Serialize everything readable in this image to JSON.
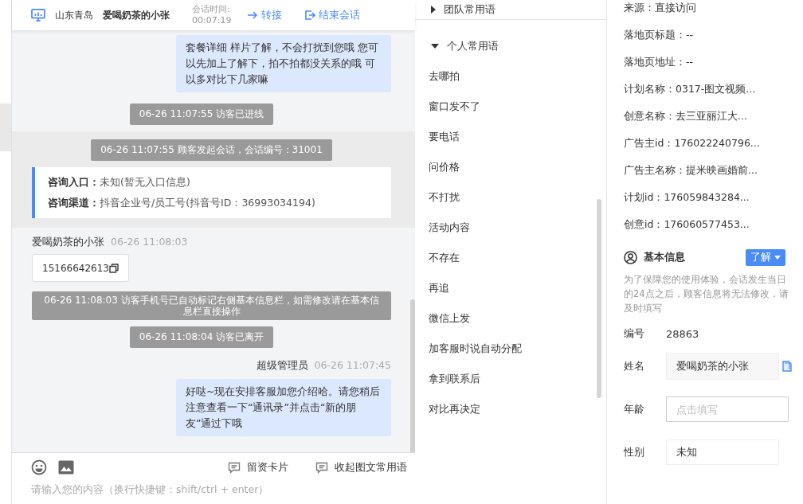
{
  "header": {
    "location": "山东青岛",
    "visitor": "爱喝奶茶的小张",
    "time_label": "会话时间:",
    "time": "00:07:19",
    "actions": [
      {
        "label": "转接",
        "kind": "transfer"
      },
      {
        "label": "结束会话",
        "kind": "end"
      }
    ]
  },
  "messages": [
    {
      "kind": "agent",
      "text": "套餐详细 样片了解，不会打扰到您哦 您可以先加上了解下，拍不拍都没关系的哦 可以多对比下几家嘛"
    },
    {
      "kind": "system",
      "text": "06-26 11:07:55 访客已进线"
    },
    {
      "kind": "session",
      "notice": "06-26 11:07:55 顾客发起会话，会话编号：31001",
      "entries": [
        {
          "label": "咨询入口：",
          "value": "未知(暂无入口信息)"
        },
        {
          "label": "咨询渠道：",
          "value": "抖音企业号/员工号(抖音号ID：36993034194)"
        }
      ]
    },
    {
      "kind": "visitor",
      "name": "爱喝奶茶的小张",
      "time": "06-26 11:08:03",
      "text": "15166642613"
    },
    {
      "kind": "notice",
      "text": "06-26 11:08:03 访客手机号已自动标记右侧基本信息栏，如需修改请在基本信息栏直接操作"
    },
    {
      "kind": "system",
      "text": "06-26 11:08:04 访客已离开"
    },
    {
      "kind": "agent",
      "name": "超级管理员",
      "time": "06-26 11:07:45",
      "text": "好哒~现在安排客服加您介绍哈。请您稍后注意查看一下“通讯录”并点击“新的朋友”通过下哦"
    }
  ],
  "input": {
    "placeholder": "请输入您的内容（换行快捷键：shift/ctrl + enter）"
  },
  "quick_replies": {
    "groups": [
      {
        "title": "团队常用语",
        "expanded": false
      },
      {
        "title": "个人常用语",
        "expanded": true,
        "items": [
          "去哪拍",
          "窗口发不了",
          "要电话",
          "问价格",
          "不打扰",
          "活动内容",
          "不存在",
          "再追",
          "微信上发",
          "加客服时说自动分配",
          "拿到联系后",
          "对比再决定"
        ]
      }
    ],
    "buttons": [
      {
        "label": "留资卡片"
      },
      {
        "label": "收起图文常用语"
      }
    ]
  },
  "source_info": [
    "来源：直接访问",
    "落地页标题：--",
    "落地页地址：--",
    "计划名称：0317-图文视频...",
    "创意名称：去三亚丽江大...",
    "广告主id：176022240796...",
    "广告主名称：提米映画婚前...",
    "计划id：176059843284...",
    "创意id：176060577453..."
  ],
  "basic_info": {
    "title": "基本信息",
    "help": "了解",
    "notice": "为了保障您的使用体验，会话发生当日的24点之后，顾客信息将无法修改，请及时填写",
    "fields": [
      {
        "label": "编号",
        "kind": "text",
        "value": "28863"
      },
      {
        "label": "姓名",
        "kind": "readonly",
        "value": "爱喝奶茶的小张"
      },
      {
        "label": "年龄",
        "kind": "input",
        "placeholder": "点击填写"
      },
      {
        "label": "性别",
        "kind": "select",
        "value": "未知"
      }
    ]
  }
}
